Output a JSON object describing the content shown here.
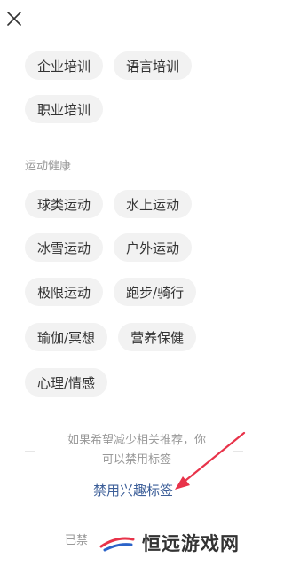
{
  "close_icon": "close-icon",
  "tag_rows": [
    [
      "企业培训",
      "语言培训"
    ],
    [
      "职业培训"
    ]
  ],
  "section": {
    "title": "运动健康",
    "tags": [
      [
        "球类运动",
        "水上运动"
      ],
      [
        "冰雪运动",
        "户外运动"
      ],
      [
        "极限运动",
        "跑步/骑行"
      ],
      [
        "瑜伽/冥想",
        "营养保健"
      ],
      [
        "心理/情感"
      ]
    ]
  },
  "hint": {
    "line1": "如果希望减少相关推荐，你",
    "line2": "可以禁用标签"
  },
  "disable_link": "禁用兴趣标签",
  "bottom_partial": "已禁",
  "watermark": "恒远游戏网",
  "colors": {
    "chip_bg": "#f2f2f2",
    "link": "#3d5f99",
    "arrow": "#e8334a",
    "muted": "#999999"
  }
}
